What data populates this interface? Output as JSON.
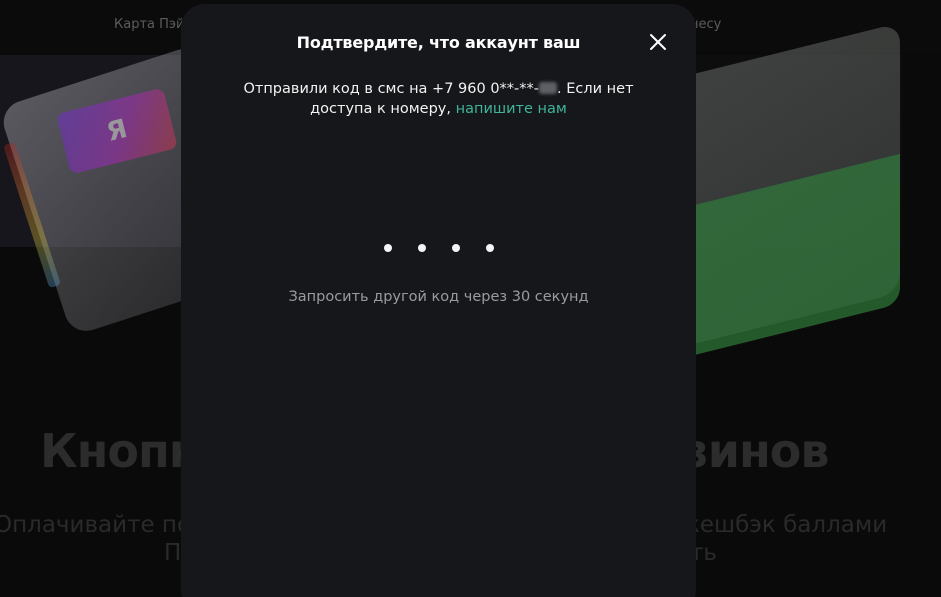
{
  "background": {
    "nav": {
      "left_link": "Карта Пэй",
      "right_link": "несу"
    },
    "logo_letter": "Я",
    "heading": {
      "left_fragment": "Кнопк",
      "right_fragment": "зинов"
    },
    "subtitle": {
      "left_line1": "Оплачивайте по",
      "left_line2": "П",
      "right_line1": "кешбэк баллами",
      "right_line2": "ть"
    }
  },
  "modal": {
    "title": "Подтвердите, что аккаунт ваш",
    "close_icon": "close-icon",
    "description": {
      "prefix": "Отправили код в смс на +7 960 0**-**-",
      "middle": ". Если нет доступа к номеру, ",
      "link": "напишите нам"
    },
    "code_input": {
      "length": 4
    },
    "resend_text": "Запросить другой код через 30 секунд"
  },
  "colors": {
    "modal_bg": "#16171a",
    "link": "#3fb49a",
    "muted_text": "#9a9aa0"
  }
}
